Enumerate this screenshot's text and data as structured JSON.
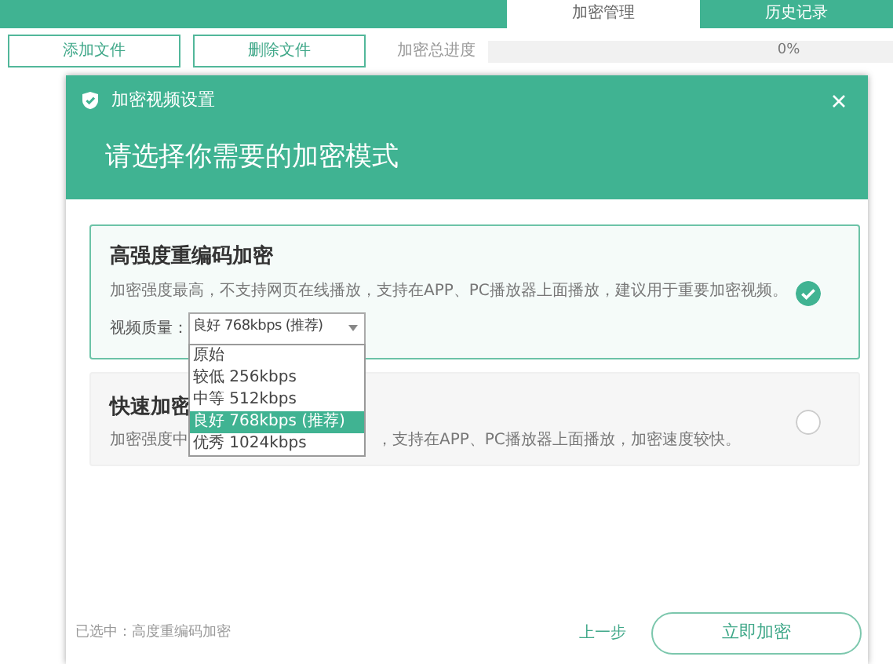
{
  "app": {
    "tabs": [
      {
        "label": "加密管理",
        "selected": true
      },
      {
        "label": "历史记录",
        "selected": false
      }
    ],
    "buttons": [
      "添加文件",
      "删除文件"
    ],
    "progress": {
      "label": "加密总进度",
      "level": 0,
      "reading": "0%"
    }
  },
  "dialog": {
    "title": "加密视频设置",
    "heading": "请选择你需要的加密模式",
    "modes": [
      {
        "title": "高强度重编码加密",
        "description": [
          "加密强度最高，不支持网页在线播放，支持在APP、PC播放器上面播放，建议用于重要加密视频。"
        ],
        "selected": true,
        "quality": {
          "label": "视频质量：",
          "value": "良好 768kbps (推荐)",
          "expanded": true,
          "options": [
            {
              "label": "原始",
              "selected": false
            },
            {
              "label": "较低 256kbps",
              "selected": false
            },
            {
              "label": "中等 512kbps",
              "selected": false
            },
            {
              "label": "良好 768kbps (推荐)",
              "selected": true
            },
            {
              "label": "优秀 1024kbps",
              "selected": false
            }
          ]
        }
      },
      {
        "title": "快速加密",
        "description": [
          "加密强度中",
          "，支持在APP、PC播放器上面播放，加密速度较快。"
        ],
        "selected": false
      }
    ],
    "footer": {
      "selection": "已选中：高度重编码加密",
      "back": "上一步",
      "confirm": "立即加密"
    }
  }
}
